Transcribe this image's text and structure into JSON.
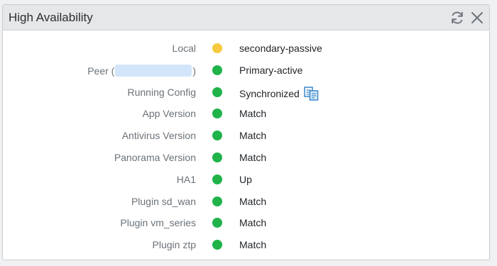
{
  "widget": {
    "title": "High Availability",
    "refresh_icon": "refresh-icon",
    "close_icon": "close-icon"
  },
  "colors": {
    "yellow": "#f7c93e",
    "green": "#20b34a"
  },
  "rows": [
    {
      "label": "Local",
      "status": "yellow",
      "value": "secondary-passive"
    },
    {
      "label_prefix": "Peer (",
      "label_suffix": ")",
      "status": "green",
      "value": "Primary-active"
    },
    {
      "label": "Running Config",
      "status": "green",
      "value": "Synchronized",
      "action_icon": "compare-config-icon"
    },
    {
      "label": "App Version",
      "status": "green",
      "value": "Match"
    },
    {
      "label": "Antivirus Version",
      "status": "green",
      "value": "Match"
    },
    {
      "label": "Panorama Version",
      "status": "green",
      "value": "Match"
    },
    {
      "label": "HA1",
      "status": "green",
      "value": "Up"
    },
    {
      "label": "Plugin sd_wan",
      "status": "green",
      "value": "Match"
    },
    {
      "label": "Plugin vm_series",
      "status": "green",
      "value": "Match"
    },
    {
      "label": "Plugin ztp",
      "status": "green",
      "value": "Match"
    }
  ]
}
